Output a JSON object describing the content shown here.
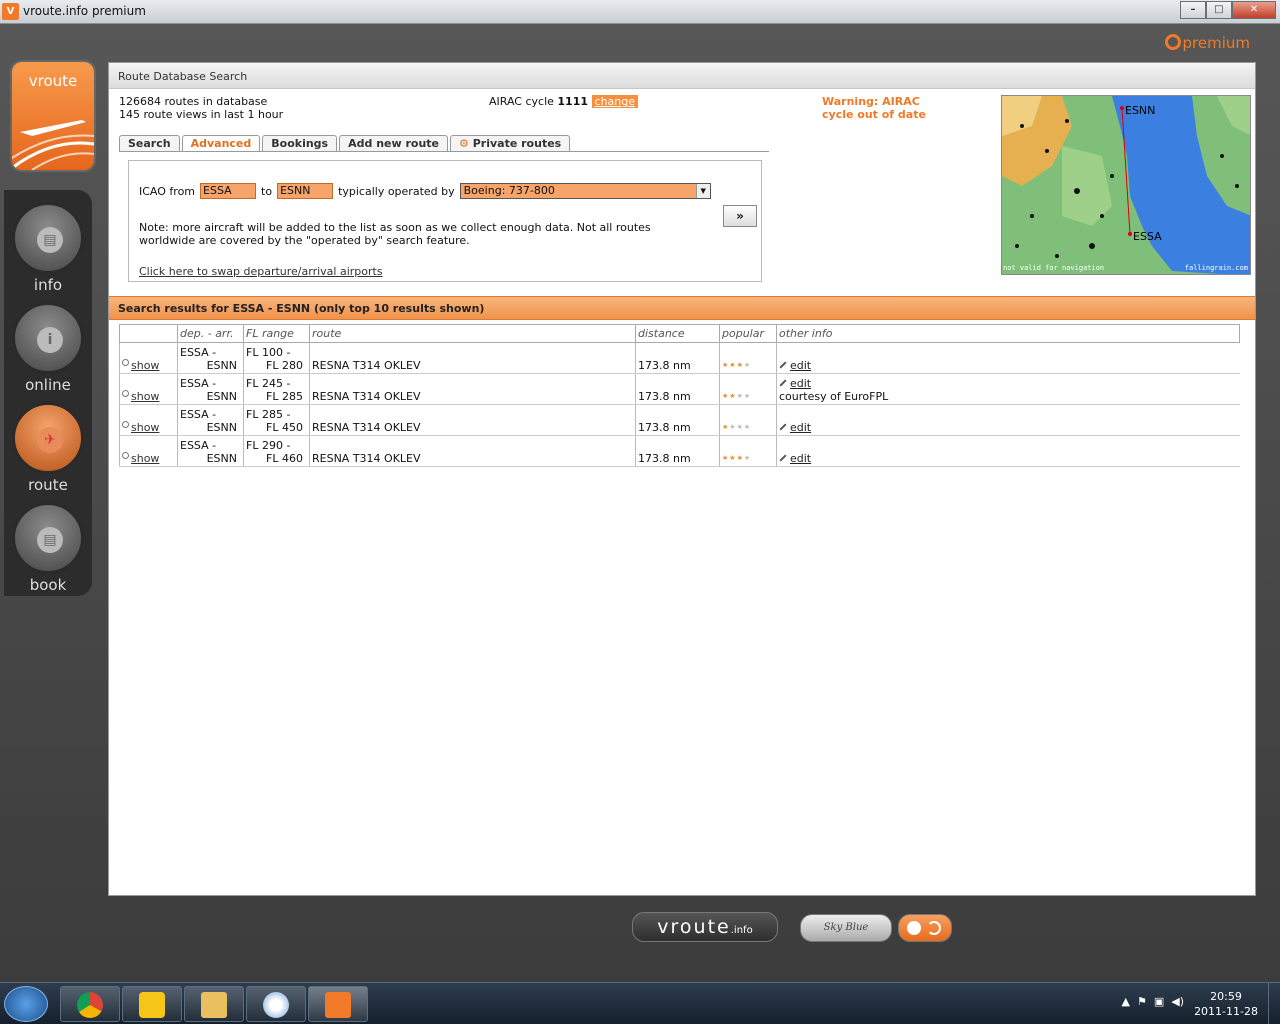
{
  "window": {
    "title": "vroute.info premium",
    "icon_text": "V",
    "controls": [
      "–",
      "□",
      "✕"
    ]
  },
  "header": {
    "premium_label": "premium"
  },
  "sidebar": {
    "logo_label": "vroute",
    "items": [
      {
        "label": "info",
        "icon": "document-icon"
      },
      {
        "label": "online",
        "icon": "info-icon"
      },
      {
        "label": "route",
        "icon": "plane-icon",
        "active": true
      },
      {
        "label": "book",
        "icon": "document-icon"
      }
    ]
  },
  "panel": {
    "title": "Route Database Search",
    "routes_count": "126684 routes in database",
    "views": "145 route views in last 1 hour",
    "airac_label": "AIRAC cycle",
    "airac_cycle": "1111",
    "airac_change": "change",
    "warning": "Warning: AIRAC cycle out of date",
    "tabs": [
      "Search",
      "Advanced",
      "Bookings",
      "Add new route",
      "Private routes"
    ],
    "active_tab": "Advanced",
    "form": {
      "icao_from_label": "ICAO from",
      "from_value": "ESSA",
      "to_label": "to",
      "to_value": "ESNN",
      "operated_label": "typically operated by",
      "aircraft_value": "Boeing: 737-800",
      "go_label": "»",
      "note": "Note: more aircraft will be added to the list as soon as we collect enough data. Not all routes worldwide are covered by the \"operated by\" search feature.",
      "swap_link": "Click here to swap departure/arrival airports"
    },
    "map": {
      "label_top": "ESNN",
      "label_bottom": "ESSA",
      "credit_left": "not valid for navigation",
      "credit_right": "fallingrain.com"
    },
    "results_title": "Search results for ESSA - ESNN (only top 10 results shown)",
    "table": {
      "headers": [
        "",
        "dep. - arr.",
        "FL range",
        "route",
        "distance",
        "popular",
        "other info"
      ],
      "rows": [
        {
          "show": "show",
          "dep": "ESSA -",
          "arr": "ESNN",
          "fl_from": "FL 100 -",
          "fl_to": "FL 280",
          "route": "RESNA T314 OKLEV",
          "distance": "173.8 nm",
          "stars": 3,
          "edit": "edit",
          "info": ""
        },
        {
          "show": "show",
          "dep": "ESSA -",
          "arr": "ESNN",
          "fl_from": "FL 245 -",
          "fl_to": "FL 285",
          "route": "RESNA T314 OKLEV",
          "distance": "173.8 nm",
          "stars": 2,
          "edit": "edit",
          "info": "courtesy of EuroFPL"
        },
        {
          "show": "show",
          "dep": "ESSA -",
          "arr": "ESNN",
          "fl_from": "FL 285 -",
          "fl_to": "FL 450",
          "route": "RESNA T314 OKLEV",
          "distance": "173.8 nm",
          "stars": 1,
          "edit": "edit",
          "info": ""
        },
        {
          "show": "show",
          "dep": "ESSA -",
          "arr": "ESNN",
          "fl_from": "FL 290 -",
          "fl_to": "FL 460",
          "route": "RESNA T314 OKLEV",
          "distance": "173.8 nm",
          "stars": 3,
          "edit": "edit",
          "info": ""
        }
      ]
    }
  },
  "footer": {
    "brand": "vroute",
    "brand_suffix": ".info",
    "skin_label": "Sky Blue"
  },
  "taskbar": {
    "time": "20:59",
    "date": "2011-11-28"
  },
  "colors": {
    "accent": "#f07a28",
    "input_bg": "#f7a46a"
  }
}
